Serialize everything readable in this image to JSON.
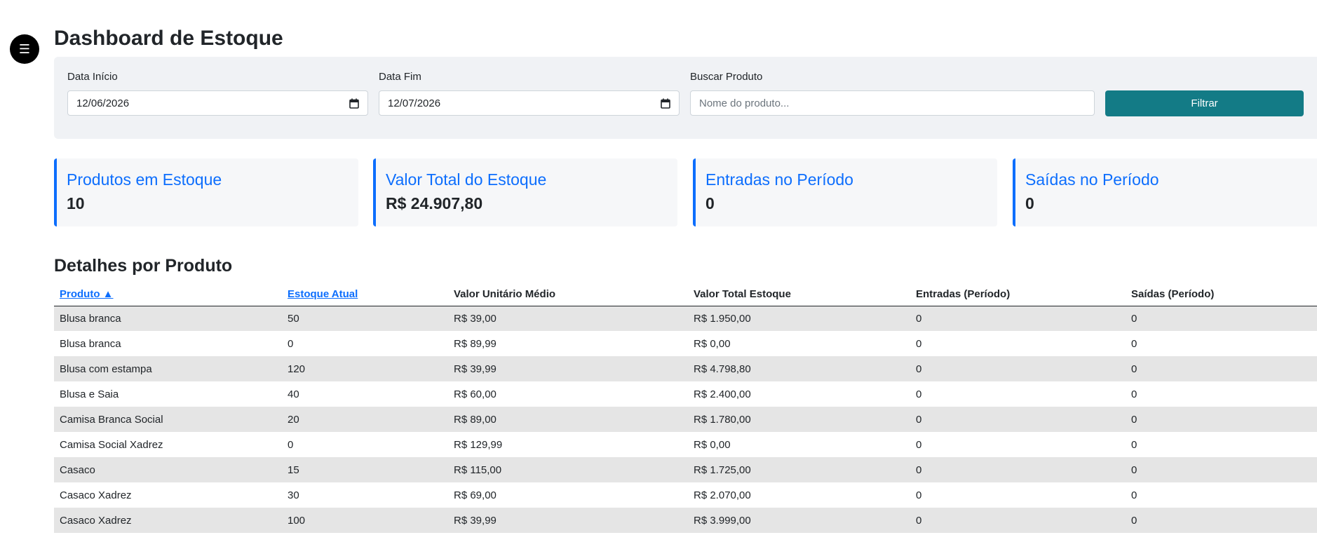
{
  "menu": {
    "icon": "hamburger-icon",
    "glyph": "☰"
  },
  "title": "Dashboard de Estoque",
  "filters": {
    "start_label": "Data Início",
    "start_value": "12/06/2026",
    "end_label": "Data Fim",
    "end_value": "12/07/2026",
    "search_label": "Buscar Produto",
    "search_placeholder": "Nome do produto...",
    "filter_button": "Filtrar"
  },
  "cards": [
    {
      "title": "Produtos em Estoque",
      "value": "10"
    },
    {
      "title": "Valor Total do Estoque",
      "value": "R$ 24.907,80"
    },
    {
      "title": "Entradas no Período",
      "value": "0"
    },
    {
      "title": "Saídas no Período",
      "value": "0"
    }
  ],
  "details": {
    "title": "Detalhes por Produto",
    "headers": {
      "produto": "Produto ▲",
      "estoque": "Estoque Atual",
      "valor_unit": "Valor Unitário Médio",
      "valor_total": "Valor Total Estoque",
      "entradas": "Entradas (Período)",
      "saidas": "Saídas (Período)"
    },
    "rows": [
      {
        "produto": "Blusa branca",
        "estoque": "50",
        "valor_unit": "R$ 39,00",
        "valor_total": "R$ 1.950,00",
        "entradas": "0",
        "saidas": "0"
      },
      {
        "produto": "Blusa branca",
        "estoque": "0",
        "valor_unit": "R$ 89,99",
        "valor_total": "R$ 0,00",
        "entradas": "0",
        "saidas": "0"
      },
      {
        "produto": "Blusa com estampa",
        "estoque": "120",
        "valor_unit": "R$ 39,99",
        "valor_total": "R$ 4.798,80",
        "entradas": "0",
        "saidas": "0"
      },
      {
        "produto": "Blusa e Saia",
        "estoque": "40",
        "valor_unit": "R$ 60,00",
        "valor_total": "R$ 2.400,00",
        "entradas": "0",
        "saidas": "0"
      },
      {
        "produto": "Camisa Branca Social",
        "estoque": "20",
        "valor_unit": "R$ 89,00",
        "valor_total": "R$ 1.780,00",
        "entradas": "0",
        "saidas": "0"
      },
      {
        "produto": "Camisa Social Xadrez",
        "estoque": "0",
        "valor_unit": "R$ 129,99",
        "valor_total": "R$ 0,00",
        "entradas": "0",
        "saidas": "0"
      },
      {
        "produto": "Casaco",
        "estoque": "15",
        "valor_unit": "R$ 115,00",
        "valor_total": "R$ 1.725,00",
        "entradas": "0",
        "saidas": "0"
      },
      {
        "produto": "Casaco Xadrez",
        "estoque": "30",
        "valor_unit": "R$ 69,00",
        "valor_total": "R$ 2.070,00",
        "entradas": "0",
        "saidas": "0"
      },
      {
        "produto": "Casaco Xadrez",
        "estoque": "100",
        "valor_unit": "R$ 39,99",
        "valor_total": "R$ 3.999,00",
        "entradas": "0",
        "saidas": "0"
      }
    ]
  },
  "colors": {
    "accent": "#0d6efd",
    "filter_button": "#137b86",
    "panel": "#f0f2f5",
    "row_stripe": "#e5e5e5"
  }
}
